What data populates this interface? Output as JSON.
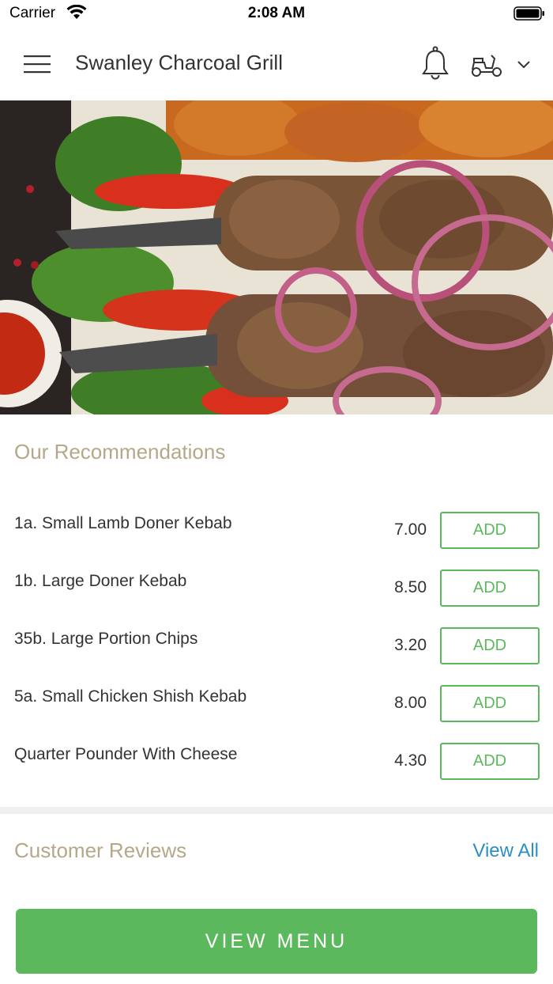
{
  "status_bar": {
    "carrier": "Carrier",
    "time": "2:08 AM"
  },
  "header": {
    "title": "Swanley Charcoal Grill",
    "icons": [
      "menu-icon",
      "bell-icon",
      "scooter-icon",
      "chevron-down-icon"
    ]
  },
  "recommendations": {
    "title": "Our Recommendations",
    "add_label": "ADD",
    "items": [
      {
        "name": "1a. Small Lamb Doner Kebab",
        "price": "7.00"
      },
      {
        "name": "1b. Large Doner Kebab",
        "price": "8.50"
      },
      {
        "name": "35b. Large Portion Chips",
        "price": "3.20"
      },
      {
        "name": "5a. Small Chicken Shish Kebab",
        "price": "8.00"
      },
      {
        "name": "Quarter Pounder With Cheese",
        "price": "4.30"
      }
    ]
  },
  "reviews": {
    "title": "Customer Reviews",
    "view_all": "View All"
  },
  "footer": {
    "view_menu": "VIEW MENU"
  },
  "colors": {
    "accent_green": "#5cb85c",
    "section_title": "#b5a88a",
    "link_blue": "#2b8fc4"
  }
}
